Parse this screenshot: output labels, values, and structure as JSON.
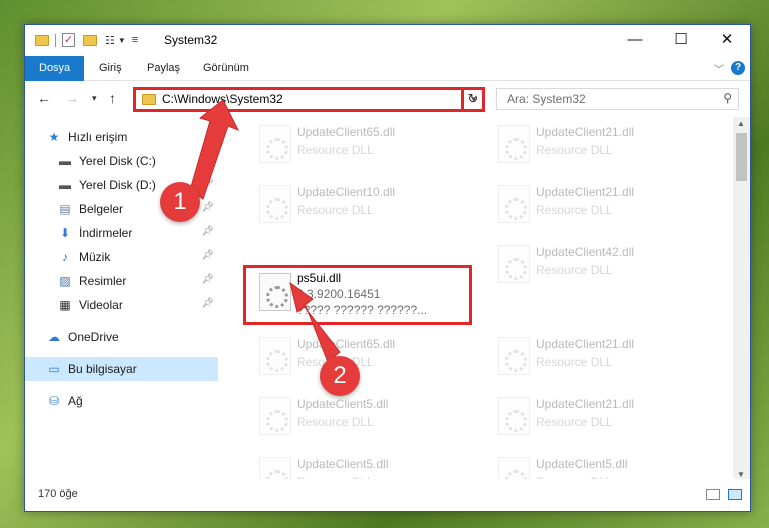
{
  "window": {
    "title": "System32",
    "minimize": "—",
    "maximize": "☐",
    "close": "✕"
  },
  "ribbon": {
    "tabs": [
      "Dosya",
      "Giriş",
      "Paylaş",
      "Görünüm"
    ],
    "accent": "#1979ca"
  },
  "address": {
    "path": "C:\\Windows\\System32",
    "search_placeholder": "Ara: System32"
  },
  "sidebar": {
    "items": [
      {
        "label": "Hızlı erişim",
        "icon": "star-icon",
        "pinned": false
      },
      {
        "label": "Yerel Disk (C:)",
        "icon": "drive-icon",
        "pinned": true
      },
      {
        "label": "Yerel Disk (D:)",
        "icon": "drive-icon",
        "pinned": true
      },
      {
        "label": "Belgeler",
        "icon": "documents-icon",
        "pinned": true
      },
      {
        "label": "İndirmeler",
        "icon": "download-icon",
        "pinned": true
      },
      {
        "label": "Müzik",
        "icon": "music-icon",
        "pinned": true
      },
      {
        "label": "Resimler",
        "icon": "pictures-icon",
        "pinned": true
      },
      {
        "label": "Videolar",
        "icon": "videos-icon",
        "pinned": true
      },
      {
        "label": "OneDrive",
        "icon": "cloud-icon",
        "pinned": false
      },
      {
        "label": "Bu bilgisayar",
        "icon": "computer-icon",
        "pinned": false,
        "selected": true
      },
      {
        "label": "Ağ",
        "icon": "network-icon",
        "pinned": false
      }
    ]
  },
  "files": {
    "left": [
      {
        "name": "UpdateClient65.dll",
        "type": "Resource DLL"
      },
      {
        "name": "UpdateClient10.dll",
        "type": "Resource DLL"
      },
      {
        "name": "ps5ui.dll",
        "version": "0.3.9200.16451",
        "desc": "????? ?????? ??????..."
      },
      {
        "name": "UpdateClient65.dll",
        "type": "Resource DLL"
      },
      {
        "name": "UpdateClient5.dll",
        "type": "Resource DLL"
      },
      {
        "name": "UpdateClient5.dll",
        "type": "Resource DLL"
      }
    ],
    "right": [
      {
        "name": "UpdateClient21.dll",
        "type": "Resource DLL"
      },
      {
        "name": "UpdateClient21.dll",
        "type": "Resource DLL"
      },
      {
        "name": "UpdateClient42.dll",
        "type": "Resource DLL"
      },
      {
        "name": "UpdateClient21.dll",
        "type": "Resource DLL"
      },
      {
        "name": "UpdateClient21.dll",
        "type": "Resource DLL"
      },
      {
        "name": "UpdateClient5.dll",
        "type": "Resource DLL"
      }
    ]
  },
  "status": {
    "count": "170 öğe"
  },
  "callouts": {
    "one": "1",
    "two": "2",
    "color": "#e0262a"
  }
}
